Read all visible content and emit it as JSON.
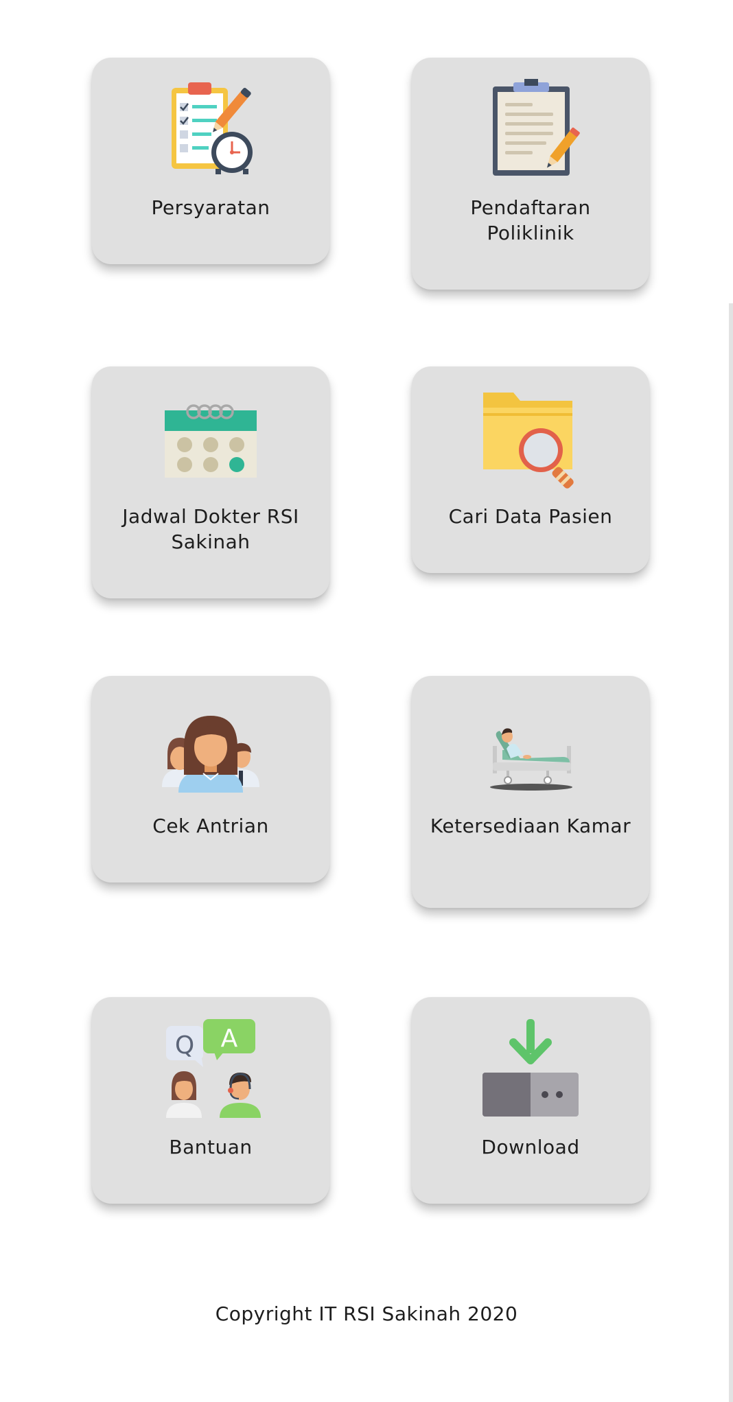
{
  "menu": {
    "items": [
      {
        "label": "Persyaratan",
        "icon": "checklist-clipboard-clock-icon"
      },
      {
        "label": "Pendaftaran Poliklinik",
        "icon": "clipboard-pencil-icon"
      },
      {
        "label": "Jadwal Dokter RSI Sakinah",
        "icon": "calendar-icon"
      },
      {
        "label": "Cari Data Pasien",
        "icon": "folder-search-icon"
      },
      {
        "label": "Cek Antrian",
        "icon": "people-queue-icon"
      },
      {
        "label": "Ketersediaan Kamar",
        "icon": "hospital-bed-patient-icon"
      },
      {
        "label": "Bantuan",
        "icon": "qa-support-icon"
      },
      {
        "label": "Download",
        "icon": "download-icon"
      }
    ]
  },
  "footer": {
    "copyright": "Copyright IT RSI Sakinah 2020"
  },
  "colors": {
    "card_background": "#e0e0e0",
    "page_background": "#ffffff",
    "text": "#1d1d1d"
  }
}
